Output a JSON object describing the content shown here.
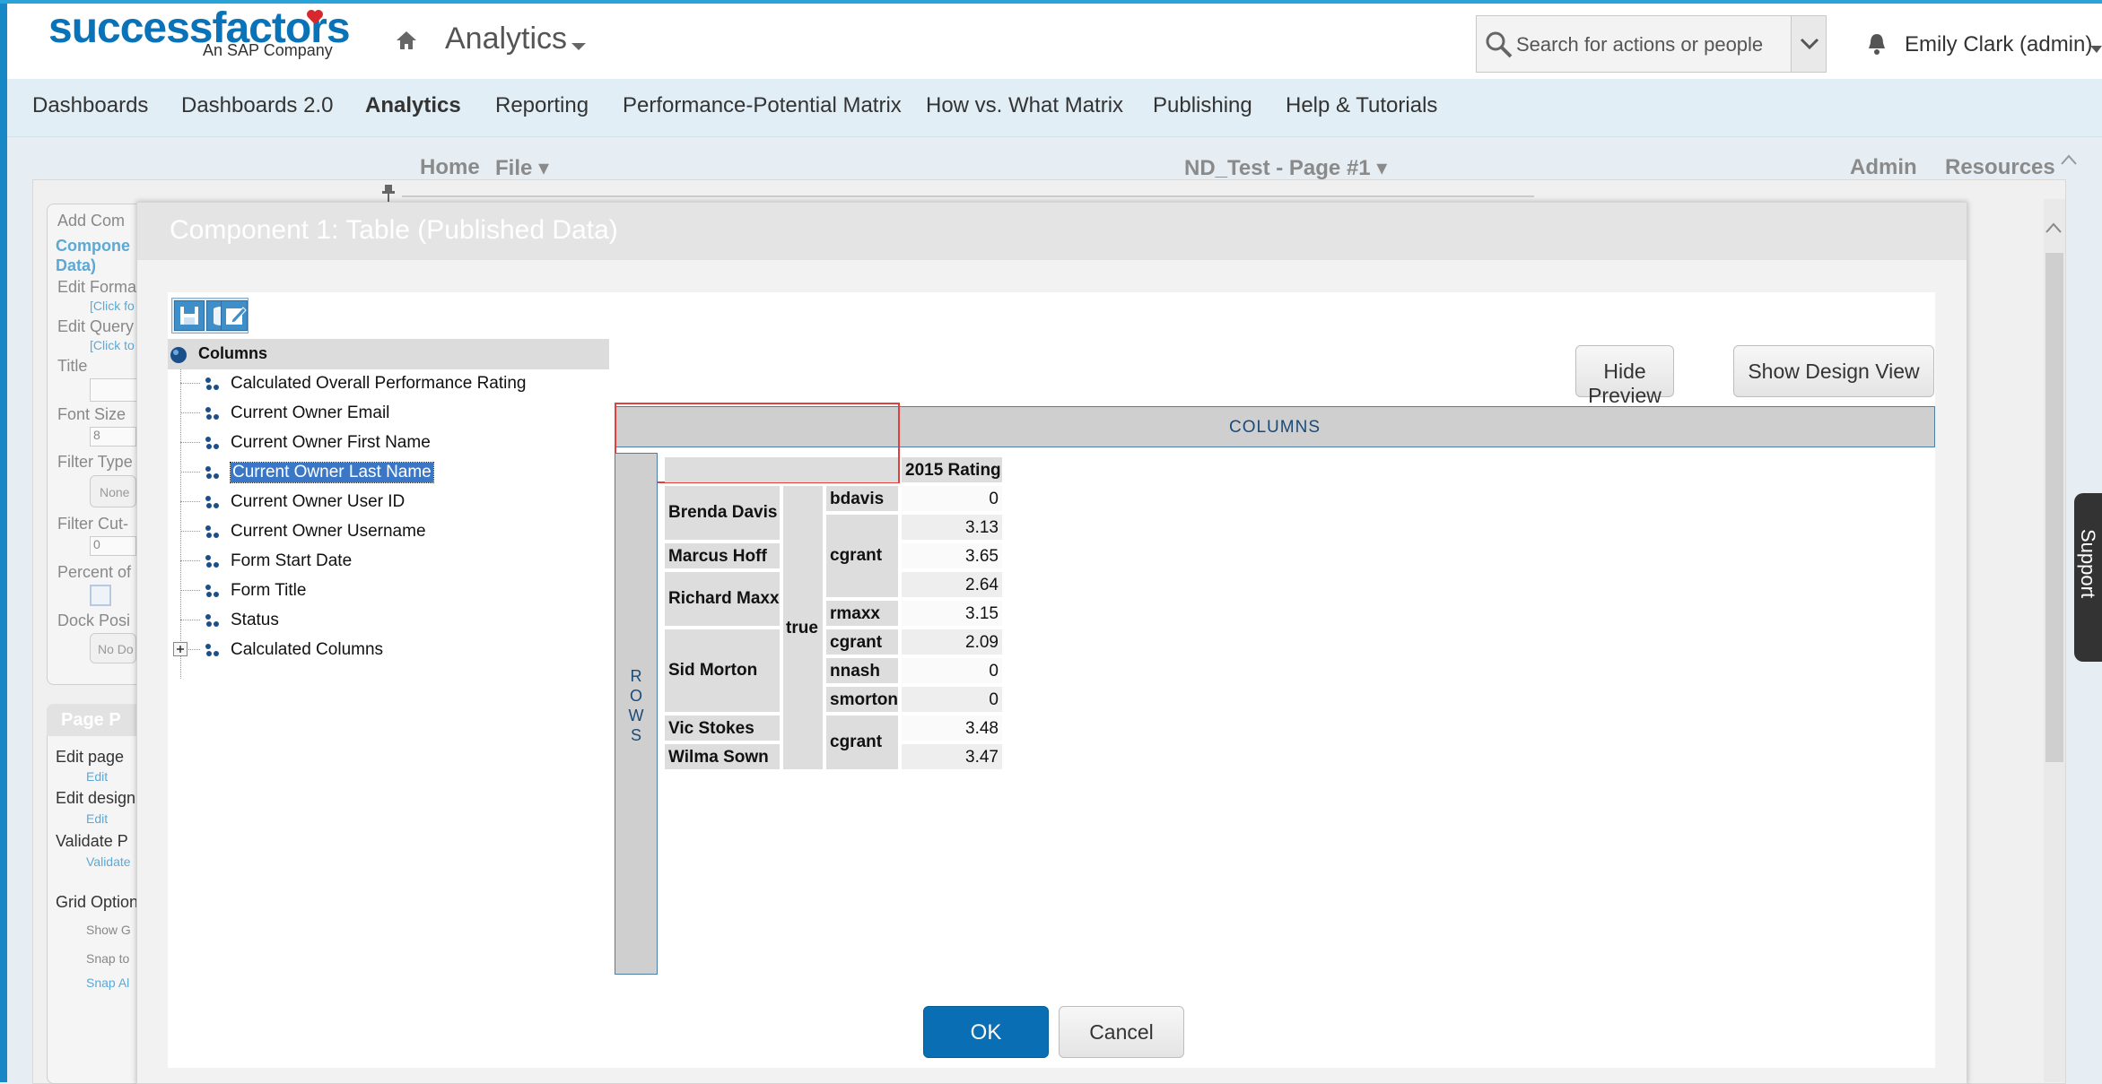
{
  "colors": {
    "brand": "#0a73b7",
    "accent": "#2aa4d8",
    "ok_button": "#0a6eb4",
    "selection": "#3a78c7"
  },
  "header": {
    "logo_text": "successfactors",
    "logo_sub": "An SAP Company",
    "module": "Analytics",
    "search_placeholder": "Search for actions or people",
    "user": "Emily Clark (admin)"
  },
  "menu": [
    "Dashboards",
    "Dashboards 2.0",
    "Analytics",
    "Reporting",
    "Performance-Potential Matrix",
    "How vs. What Matrix",
    "Publishing",
    "Help & Tutorials"
  ],
  "subtoolbar": {
    "home": "Home",
    "file": "File ▾",
    "page": "ND_Test - Page #1 ▾",
    "admin": "Admin",
    "resources": "Resources"
  },
  "sidebar": {
    "add_comp": "Add Com",
    "component_link": "Compone",
    "component_link2": "Data)",
    "edit_format": "Edit Forma",
    "click_hint_1": "[Click fo",
    "edit_query": "Edit Query",
    "click_hint_2": "[Click to",
    "title": "Title",
    "font_size": "Font Size",
    "font_size_value": "8",
    "filter_type": "Filter Type",
    "filter_type_value": "None",
    "filter_cut": "Filter Cut-",
    "filter_cut_value": "0",
    "percent_of": "Percent of",
    "dock_pos": "Dock Posi",
    "dock_value": "No Do",
    "page_p": "Page P",
    "edit_page": "Edit page",
    "edit_page_link": "Edit",
    "edit_design": "Edit design",
    "edit_design_link": "Edit",
    "validate": "Validate P",
    "validate_link": "Validate",
    "grid_options": "Grid Option",
    "show_grid": "Show G",
    "snap_to": "Snap to",
    "snap_all": "Snap Al"
  },
  "dialog": {
    "title": "Component 1: Table (Published Data)",
    "tree_root": "Columns",
    "tree_items": [
      "Calculated Overall Performance Rating",
      "Current Owner Email",
      "Current Owner First Name",
      "Current Owner Last Name",
      "Current Owner User ID",
      "Current Owner Username",
      "Form Start Date",
      "Form Title",
      "Status",
      "Calculated Columns"
    ],
    "hide_preview": "Hide Preview",
    "show_design": "Show Design View",
    "columns_label": "COLUMNS",
    "rows_label": [
      "R",
      "O",
      "W",
      "S"
    ],
    "ok": "OK",
    "cancel": "Cancel",
    "support": "Support"
  },
  "table": {
    "header": "2015 Rating",
    "names": [
      "Brenda Davis",
      "Marcus Hoff",
      "Richard Maxx",
      "Sid Morton",
      "Vic Stokes",
      "Wilma Sown"
    ],
    "status": "true",
    "usernames": [
      "bdavis",
      "cgrant",
      "rmaxx",
      "cgrant",
      "nnash",
      "smorton",
      "cgrant"
    ],
    "values": [
      "0",
      "3.13",
      "3.65",
      "2.64",
      "3.15",
      "2.09",
      "0",
      "0",
      "3.48",
      "3.47"
    ]
  }
}
